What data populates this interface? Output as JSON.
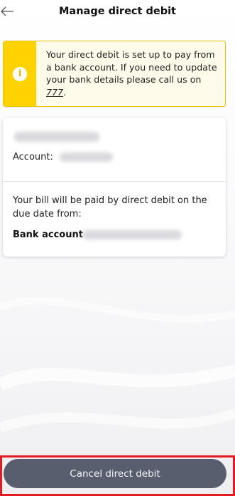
{
  "header": {
    "back_icon": "arrow-left-icon",
    "title": "Manage direct debit"
  },
  "notice": {
    "icon": "info-icon",
    "icon_glyph": "i",
    "text_before": "Your direct debit is set up to pay from a bank account. If you need to update your bank details please call us on ",
    "phone": "777",
    "text_after": ".",
    "colors": {
      "strip": "#ffd200",
      "border": "#e8c300",
      "background": "#fffbea"
    }
  },
  "account_card": {
    "account_label": "Account:",
    "paid_text": "Your bill will be paid by direct debit on the due date from:",
    "bank_label": "Bank account"
  },
  "footer": {
    "cancel_label": "Cancel direct debit",
    "colors": {
      "button": "#585e6e",
      "highlight_border": "#e31b23"
    }
  }
}
